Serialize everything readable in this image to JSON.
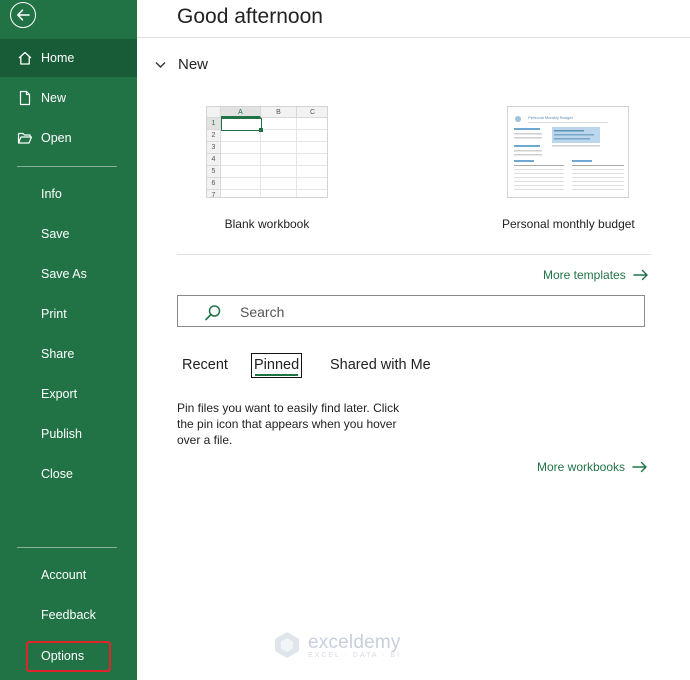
{
  "sidebar": {
    "back_label": "Back",
    "items": [
      {
        "label": "Home",
        "icon": "home-icon",
        "active": true
      },
      {
        "label": "New",
        "icon": "new-file-icon"
      },
      {
        "label": "Open",
        "icon": "folder-open-icon"
      },
      {
        "label": "Info"
      },
      {
        "label": "Save"
      },
      {
        "label": "Save As"
      },
      {
        "label": "Print"
      },
      {
        "label": "Share"
      },
      {
        "label": "Export"
      },
      {
        "label": "Publish"
      },
      {
        "label": "Close"
      },
      {
        "label": "Account"
      },
      {
        "label": "Feedback"
      },
      {
        "label": "Options",
        "highlighted": true
      }
    ]
  },
  "main": {
    "greeting": "Good afternoon",
    "new_section": {
      "title": "New",
      "templates": [
        {
          "label": "Blank workbook"
        },
        {
          "label": "Personal monthly budget"
        }
      ],
      "blank_grid": {
        "columns": [
          "A",
          "B",
          "C"
        ],
        "rows": [
          "1",
          "2",
          "3",
          "4",
          "5",
          "6",
          "7"
        ]
      },
      "budget_thumb_title": "Personal Monthly Budget",
      "more_templates": "More templates"
    },
    "search": {
      "placeholder": "Search"
    },
    "tabs": [
      {
        "label": "Recent"
      },
      {
        "label": "Pinned",
        "selected": true
      },
      {
        "label": "Shared with Me"
      }
    ],
    "pinned_message": "Pin files you want to easily find later. Click the pin icon that appears when you hover over a file.",
    "more_workbooks": "More workbooks"
  },
  "watermark": {
    "brand": "exceldemy",
    "tagline": "EXCEL · DATA · BI"
  },
  "colors": {
    "accent": "#217346",
    "sidebar_active": "#185c37",
    "highlight_frame": "#e0242b"
  }
}
